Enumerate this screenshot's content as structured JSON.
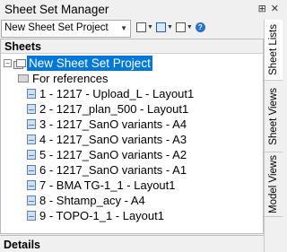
{
  "window": {
    "title": "Sheet Set Manager"
  },
  "titlebar_icons": {
    "pin": "⊞",
    "close": "✕"
  },
  "toolbar": {
    "dropdown_value": "New Sheet Set Project"
  },
  "sections": {
    "sheets": "Sheets",
    "details": "Details"
  },
  "tree": {
    "root": "New Sheet Set Project",
    "subset": "For references",
    "sheets": [
      "1 - 1217 - Upload_L - Layout1",
      "2 - 1217_plan_500 - Layout1",
      "3 - 1217_SanO variants - A4",
      "4 - 1217_SanO variants - A3",
      "5 - 1217_SanO variants - A2",
      "6 - 1217_SanO variants - A1",
      "7 - BMA TG-1_1 - Layout1",
      "8 - Shtamp_acy - A4",
      "9 - TOPO-1_1 - Layout1"
    ]
  },
  "side_tabs": [
    "Sheet Lists",
    "Sheet Views",
    "Model Views"
  ],
  "colors": {
    "selection": "#0078d7",
    "panel_bg": "#ffffff",
    "chrome_bg": "#f0f0f0"
  }
}
